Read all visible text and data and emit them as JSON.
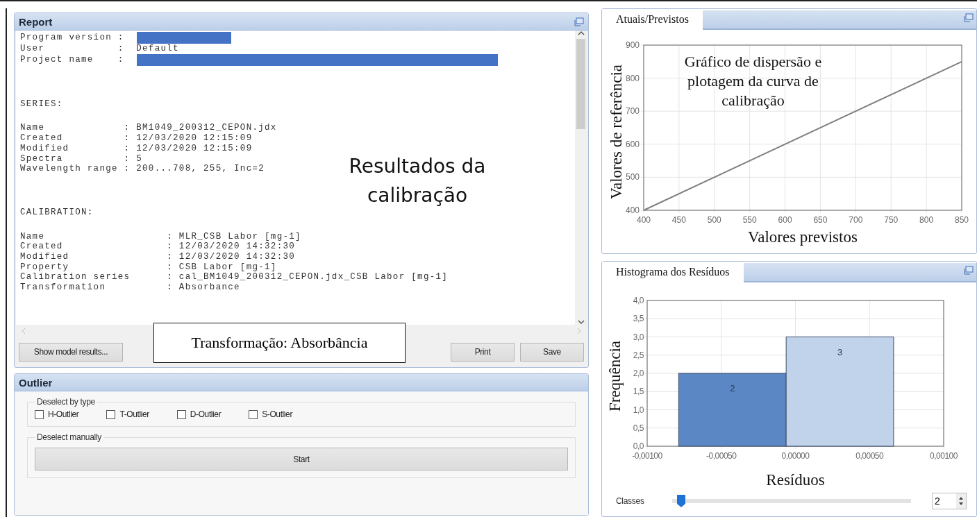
{
  "report": {
    "title": "Report",
    "lines": [
      {
        "kind": "redacted_short",
        "text": "Program version :"
      },
      {
        "kind": "text",
        "text": "User            :  Default"
      },
      {
        "kind": "redacted_long",
        "text": "Project name    :"
      }
    ],
    "sections": [
      {
        "heading": "SERIES:",
        "lines": [
          "Name             : BM1049_200312_CEPON.jdx",
          "Created          : 12/03/2020 12:15:09",
          "Modified         : 12/03/2020 12:15:09",
          "Spectra          : 5",
          "Wavelength range : 200...708, 255, Inc=2"
        ]
      },
      {
        "heading": "CALIBRATION:",
        "lines": [
          "Name                    : MLR_CSB Labor [mg-1]",
          "Created                 : 12/03/2020 14:32:30",
          "Modified                : 12/03/2020 14:32:30",
          "Property                : CSB Labor [mg-1]",
          "Calibration series      : cal_BM1049_200312_CEPON.jdx_CSB Labor [mg-1]",
          "Transformation          : Absorbance"
        ]
      }
    ],
    "annotation": "Resultados da calibração",
    "callout": "Transformação: Absorbância",
    "buttons": [
      {
        "kind": "left",
        "label": "Show model results..."
      },
      {
        "kind": "right",
        "label": "Print"
      },
      {
        "kind": "right",
        "label": "Save"
      }
    ]
  },
  "outlier": {
    "title": "Outlier",
    "type_group": {
      "title": "Deselect by type",
      "checkboxes": [
        {
          "label": "H-Outlier",
          "checked": false
        },
        {
          "label": "T-Outlier",
          "checked": false
        },
        {
          "label": "D-Outlier",
          "checked": false
        },
        {
          "label": "S-Outlier",
          "checked": false
        }
      ]
    },
    "manual_group": {
      "title": "Deselect manually",
      "button": "Start"
    }
  },
  "scatter_panel": {
    "title": "Atuais/Previstos",
    "annotation": "Gráfico de dispersão e plotagem da curva de calibração",
    "chart_data": {
      "type": "line",
      "xlabel": "Valores previstos",
      "ylabel": "Valores de referência",
      "x": [
        400,
        850
      ],
      "series": [
        {
          "color": "#808080",
          "values": [
            400,
            850
          ]
        }
      ],
      "xlim": [
        400,
        850
      ],
      "ylim": [
        400,
        900
      ],
      "grid": true,
      "xticks": [
        400,
        450,
        500,
        550,
        600,
        650,
        700,
        750,
        800,
        850
      ],
      "yticks": [
        400,
        500,
        600,
        700,
        800,
        900
      ]
    }
  },
  "histogram_panel": {
    "title": "Histograma dos Resíduos",
    "chart_data": {
      "type": "bar",
      "xlabel": "Resíduos",
      "ylabel": "Frequência",
      "x": [
        -0.000425,
        0.0003
      ],
      "grid": true,
      "data_labels": true,
      "series": [
        {
          "color": "#5b87c5",
          "values": [
            2,
            null
          ]
        },
        {
          "color": "#c0d3ea",
          "values": [
            null,
            3
          ]
        }
      ],
      "xlim": [
        -0.001,
        0.001
      ],
      "ylim": [
        0,
        4
      ],
      "xticks": [
        {
          "value": -0.001,
          "label": "-0,00100"
        },
        {
          "value": -0.0005,
          "label": "-0,00050"
        },
        {
          "value": 0,
          "label": "0,00000"
        },
        {
          "value": 0.0005,
          "label": "0,00050"
        },
        {
          "value": 0.001,
          "label": "0,00100"
        }
      ],
      "yticks": [
        {
          "value": 0,
          "label": "0,0"
        },
        {
          "value": 0.5,
          "label": "0,5"
        },
        {
          "value": 1,
          "label": "1,0"
        },
        {
          "value": 1.5,
          "label": "1,5"
        },
        {
          "value": 2,
          "label": "2,0"
        },
        {
          "value": 2.5,
          "label": "2,5"
        },
        {
          "value": 3,
          "label": "3,0"
        },
        {
          "value": 3.5,
          "label": "3,5"
        },
        {
          "value": 4,
          "label": "4,0"
        }
      ]
    },
    "classes": {
      "label": "Classes",
      "level": 0.02,
      "value": "2"
    }
  }
}
